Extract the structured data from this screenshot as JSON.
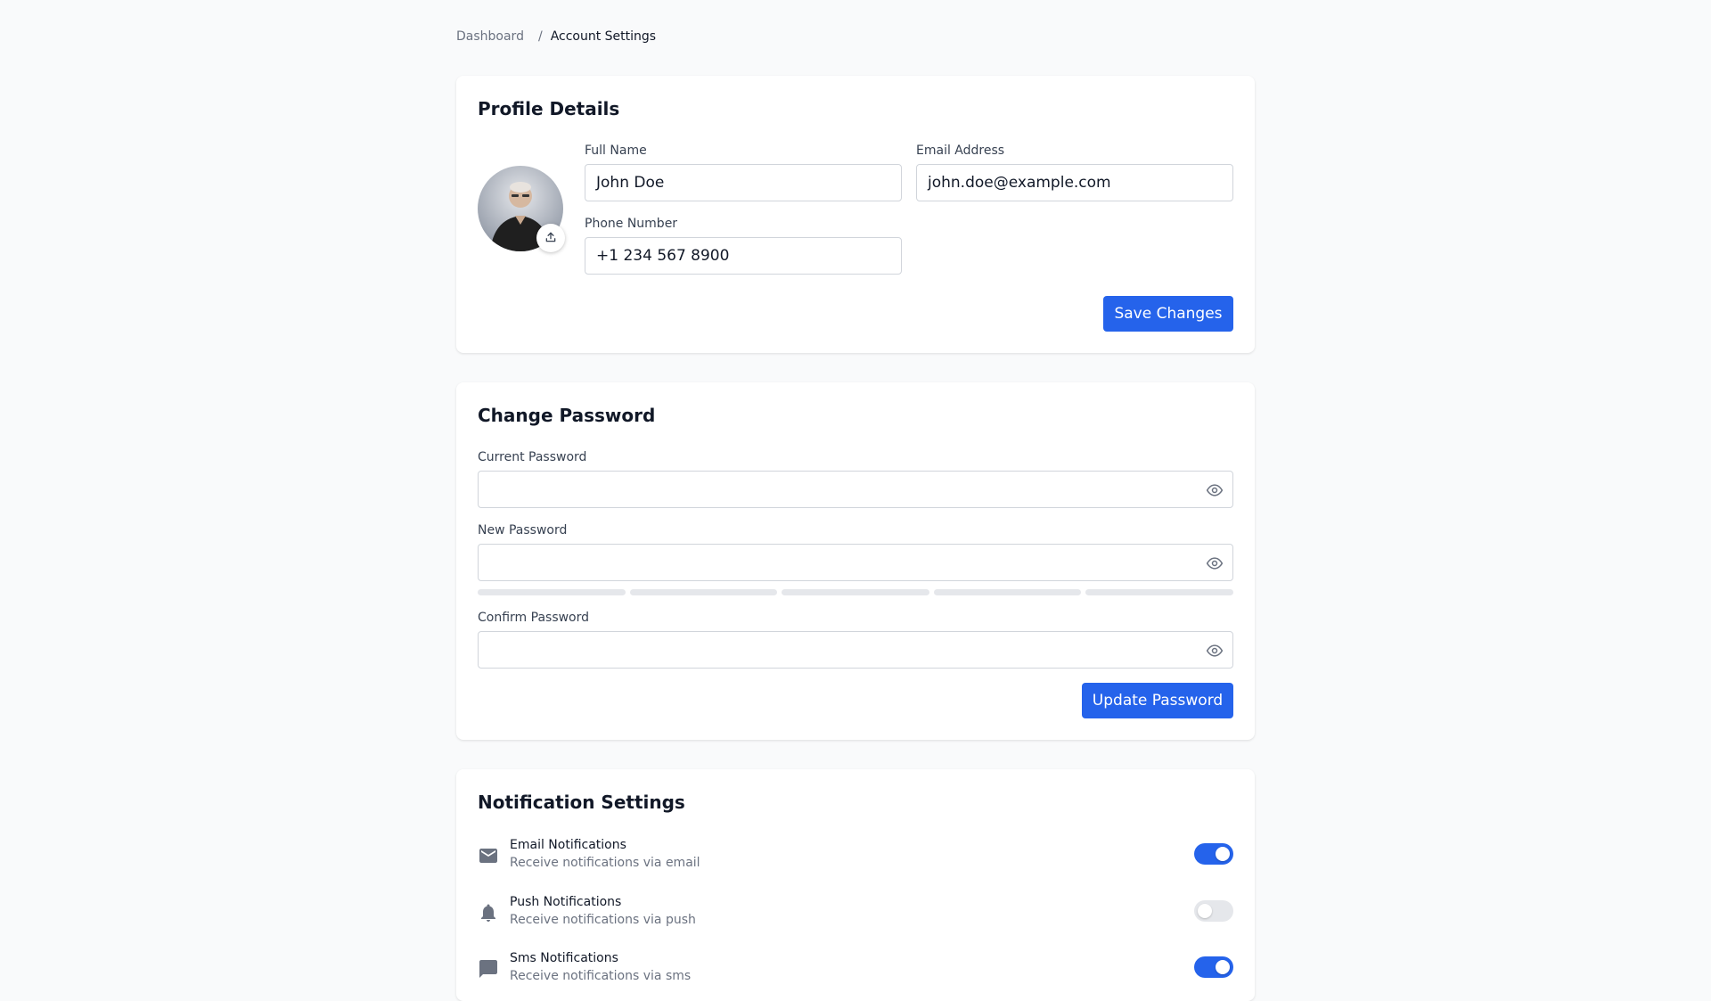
{
  "breadcrumb": {
    "items": [
      {
        "label": "Dashboard"
      },
      {
        "label": "Account Settings"
      }
    ],
    "separator": "/"
  },
  "profile": {
    "title": "Profile Details",
    "avatar_alt": "Profile photo",
    "upload_icon": "upload-icon",
    "full_name_label": "Full Name",
    "full_name_value": "John Doe",
    "email_label": "Email Address",
    "email_value": "john.doe@example.com",
    "phone_label": "Phone Number",
    "phone_value": "+1 234 567 8900",
    "save_label": "Save Changes"
  },
  "password": {
    "title": "Change Password",
    "current_label": "Current Password",
    "current_value": "",
    "new_label": "New Password",
    "new_value": "",
    "strength_segments": 5,
    "strength_filled": 0,
    "confirm_label": "Confirm Password",
    "confirm_value": "",
    "update_label": "Update Password",
    "visibility_icon": "eye-icon"
  },
  "notifications": {
    "title": "Notification Settings",
    "items": [
      {
        "icon": "mail-icon",
        "title": "Email Notifications",
        "desc": "Receive notifications via email",
        "enabled": true
      },
      {
        "icon": "bell-icon",
        "title": "Push Notifications",
        "desc": "Receive notifications via push",
        "enabled": false
      },
      {
        "icon": "sms-icon",
        "title": "Sms Notifications",
        "desc": "Receive notifications via sms",
        "enabled": true
      }
    ]
  },
  "colors": {
    "accent": "#2563eb",
    "background": "#f9fafb",
    "card": "#ffffff",
    "muted_text": "#6b7280",
    "toggle_off": "#e5e7eb"
  }
}
